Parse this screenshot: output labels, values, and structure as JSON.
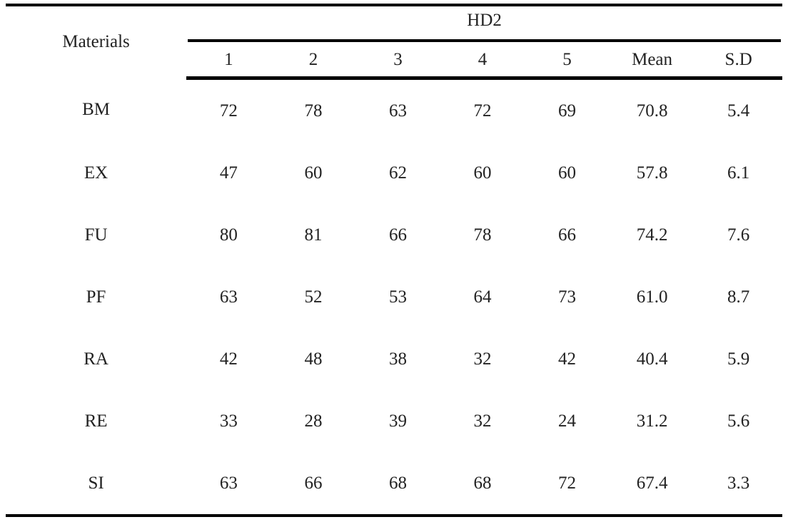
{
  "table": {
    "row_header_label": "Materials",
    "group_header": "HD2",
    "columns": [
      "1",
      "2",
      "3",
      "4",
      "5",
      "Mean",
      "S.D"
    ],
    "rows": [
      {
        "material": "BM",
        "values": [
          "72",
          "78",
          "63",
          "72",
          "69"
        ],
        "mean": "70.8",
        "sd": "5.4"
      },
      {
        "material": "EX",
        "values": [
          "47",
          "60",
          "62",
          "60",
          "60"
        ],
        "mean": "57.8",
        "sd": "6.1"
      },
      {
        "material": "FU",
        "values": [
          "80",
          "81",
          "66",
          "78",
          "66"
        ],
        "mean": "74.2",
        "sd": "7.6"
      },
      {
        "material": "PF",
        "values": [
          "63",
          "52",
          "53",
          "64",
          "73"
        ],
        "mean": "61.0",
        "sd": "8.7"
      },
      {
        "material": "RA",
        "values": [
          "42",
          "48",
          "38",
          "32",
          "42"
        ],
        "mean": "40.4",
        "sd": "5.9"
      },
      {
        "material": "RE",
        "values": [
          "33",
          "28",
          "39",
          "32",
          "24"
        ],
        "mean": "31.2",
        "sd": "5.6"
      },
      {
        "material": "SI",
        "values": [
          "63",
          "66",
          "68",
          "68",
          "72"
        ],
        "mean": "67.4",
        "sd": "3.3"
      }
    ]
  },
  "chart_data": {
    "type": "table",
    "title": "HD2",
    "xlabel": "",
    "ylabel": "",
    "categories": [
      "BM",
      "EX",
      "FU",
      "PF",
      "RA",
      "RE",
      "SI"
    ],
    "columns": [
      "1",
      "2",
      "3",
      "4",
      "5",
      "Mean",
      "S.D"
    ],
    "series": [
      {
        "name": "1",
        "values": [
          72,
          47,
          80,
          63,
          42,
          33,
          63
        ]
      },
      {
        "name": "2",
        "values": [
          78,
          60,
          81,
          52,
          48,
          28,
          66
        ]
      },
      {
        "name": "3",
        "values": [
          63,
          62,
          66,
          53,
          38,
          39,
          68
        ]
      },
      {
        "name": "4",
        "values": [
          72,
          60,
          78,
          64,
          32,
          32,
          68
        ]
      },
      {
        "name": "5",
        "values": [
          69,
          60,
          66,
          73,
          42,
          24,
          72
        ]
      },
      {
        "name": "Mean",
        "values": [
          70.8,
          57.8,
          74.2,
          61.0,
          40.4,
          31.2,
          67.4
        ]
      },
      {
        "name": "S.D",
        "values": [
          5.4,
          6.1,
          7.6,
          8.7,
          5.9,
          5.6,
          3.3
        ]
      }
    ]
  }
}
